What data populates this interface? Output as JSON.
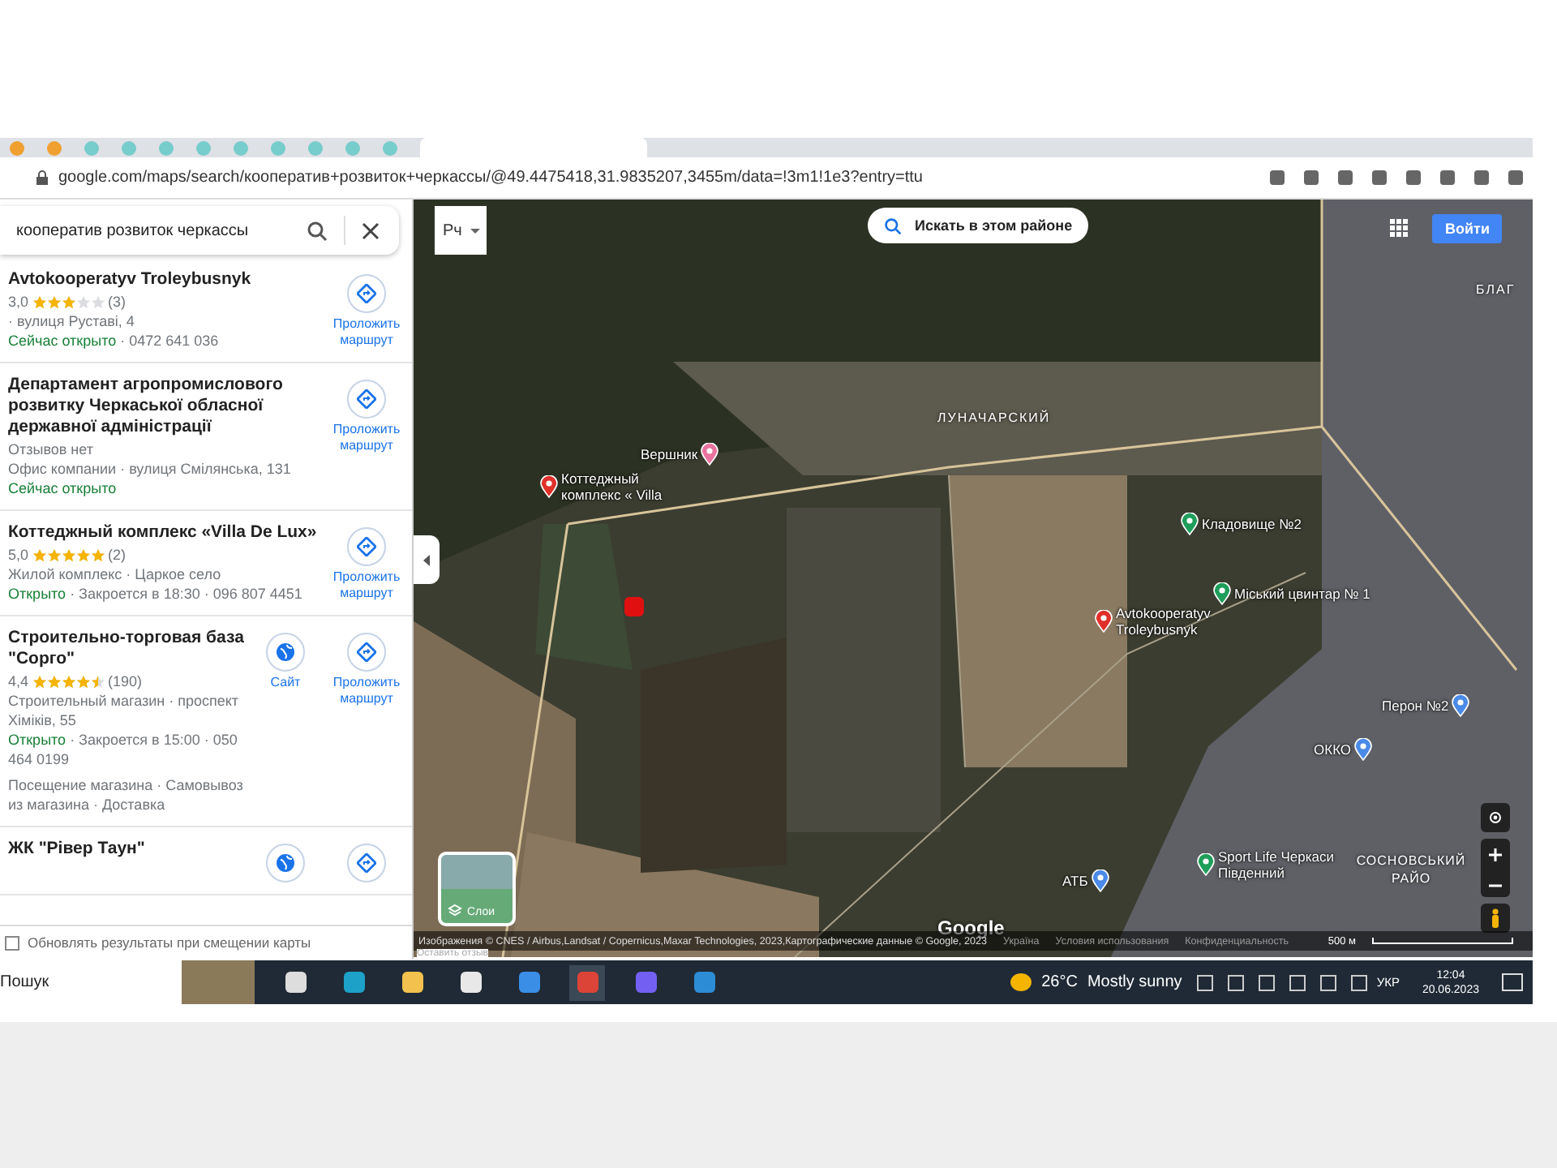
{
  "browser": {
    "url": "google.com/maps/search/кооператив+розвиток+черкассы/@49.4475418,31.9835207,3455m/data=!3m1!1e3?entry=ttu"
  },
  "search": {
    "value": "кооператив розвиток черкассы"
  },
  "results": [
    {
      "name": "Avtokooperatyv Troleybusnyk",
      "rating": "3,0",
      "stars": 3,
      "reviews": "(3)",
      "lines": [
        {
          "text": "· вулиця Руставі, 4"
        },
        {
          "status": "Сейчас открыто",
          "text": " · 0472 641 036"
        }
      ],
      "actions": [
        {
          "kind": "route",
          "label": "Проложить маршрут"
        }
      ]
    },
    {
      "name": "Департамент агропромислового розвитку Черкаської обласної державної адміністрації",
      "lines": [
        {
          "text": "Отзывов нет"
        },
        {
          "text": "Офис компании · вулиця Смілянська, 131"
        },
        {
          "status": "Сейчас открыто"
        }
      ],
      "actions": [
        {
          "kind": "route",
          "label": "Проложить маршрут"
        }
      ]
    },
    {
      "name": "Коттеджный комплекс «Villa De Lux»",
      "rating": "5,0",
      "stars": 5,
      "reviews": "(2)",
      "lines": [
        {
          "text": "Жилой комплекс · Царкое село"
        },
        {
          "status": "Открыто",
          "text": " · Закроется в 18:30 · 096 807 4451"
        }
      ],
      "actions": [
        {
          "kind": "route",
          "label": "Проложить маршрут"
        }
      ]
    },
    {
      "name": "Строительно-торговая база \"Сорго\"",
      "rating": "4,4",
      "stars": 4.5,
      "reviews": "(190)",
      "lines": [
        {
          "text": "Строительный магазин · проспект Хіміків, 55"
        },
        {
          "status": "Открыто",
          "text": " · Закроется в 15:00 · 050 464 0199"
        }
      ],
      "notes": "Посещение магазина · Самовывоз из магазина · Доставка",
      "actions": [
        {
          "kind": "website",
          "label": "Сайт"
        },
        {
          "kind": "route",
          "label": "Проложить маршрут"
        }
      ]
    },
    {
      "name": "ЖК \"Рівер Таун\"",
      "actions": [
        {
          "kind": "website"
        },
        {
          "kind": "route"
        }
      ]
    }
  ],
  "update_on_move": {
    "label": "Обновлять результаты при смещении карты",
    "checked": false
  },
  "map": {
    "language": "Рч",
    "search_area": "Искать в этом районе",
    "sign_in": "Войти",
    "labels": [
      {
        "kind": "area",
        "text": "ЛУНАЧАРСКИЙ"
      },
      {
        "kind": "area",
        "text": "БЛАГ"
      },
      {
        "kind": "hotel",
        "text": "Вершник"
      },
      {
        "kind": "result",
        "text": "Коттеджный комплекс « Villa"
      },
      {
        "kind": "park",
        "text": "Кладовище №2"
      },
      {
        "kind": "park",
        "text": "Міський цвинтар № 1"
      },
      {
        "kind": "result",
        "text": "Avtokooperatyv Troleybusnyk"
      },
      {
        "kind": "shop",
        "text": "Перон №2"
      },
      {
        "kind": "shop",
        "text": "ОККО"
      },
      {
        "kind": "shop",
        "text": "АТБ"
      },
      {
        "kind": "park",
        "text": "Sport Life Черкаси Південний"
      },
      {
        "kind": "area",
        "text": "СОСНОВСЬКИЙ РАЙО"
      }
    ],
    "logo": "Google",
    "layers": "Слои",
    "footer": [
      "Изображения © CNES / Airbus,Landsat / Copernicus,Maxar Technologies, 2023,Картографические данные © Google, 2023",
      "Україна",
      "Условия использования",
      "Конфиденциальность"
    ],
    "scale": "500 м",
    "feedback": "Оставить отзыв"
  },
  "taskbar": {
    "search": "Пошук",
    "temperature": "26°C",
    "weather": "Mostly sunny",
    "language": "УКР",
    "time": "12:04",
    "date": "20.06.2023"
  }
}
